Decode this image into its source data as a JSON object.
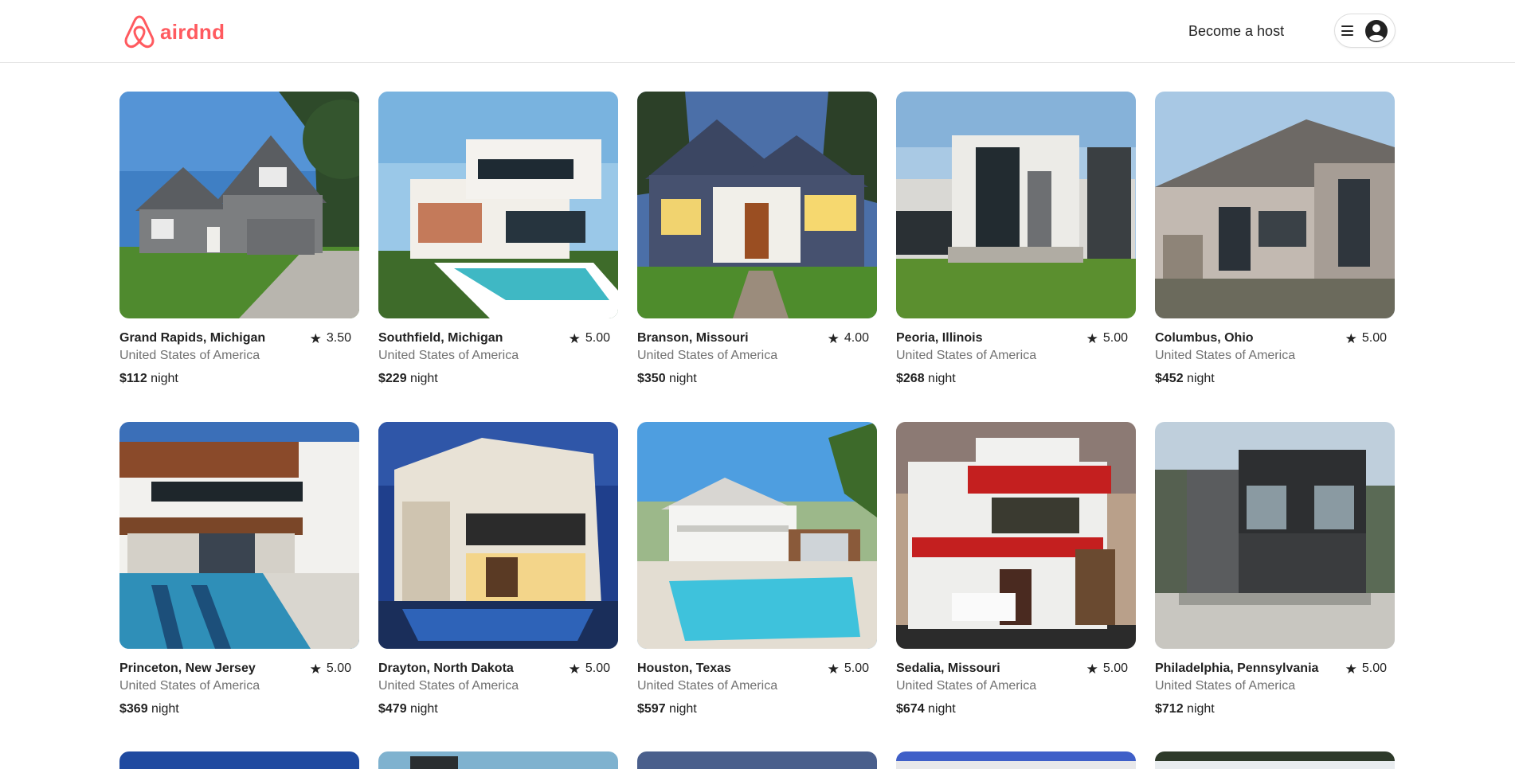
{
  "header": {
    "logo_text": "airdnd",
    "brand_color": "#ff5a5f",
    "host_label": "Become a host",
    "menu_icon": "hamburger-icon",
    "avatar_icon": "user-circle-icon"
  },
  "listings": [
    {
      "location": "Grand Rapids, Michigan",
      "country": "United States of America",
      "rating": "3.50",
      "price": "$112",
      "unit": "night"
    },
    {
      "location": "Southfield, Michigan",
      "country": "United States of America",
      "rating": "5.00",
      "price": "$229",
      "unit": "night"
    },
    {
      "location": "Branson, Missouri",
      "country": "United States of America",
      "rating": "4.00",
      "price": "$350",
      "unit": "night"
    },
    {
      "location": "Peoria, Illinois",
      "country": "United States of America",
      "rating": "5.00",
      "price": "$268",
      "unit": "night"
    },
    {
      "location": "Columbus, Ohio",
      "country": "United States of America",
      "rating": "5.00",
      "price": "$452",
      "unit": "night"
    },
    {
      "location": "Princeton, New Jersey",
      "country": "United States of America",
      "rating": "5.00",
      "price": "$369",
      "unit": "night"
    },
    {
      "location": "Drayton, North Dakota",
      "country": "United States of America",
      "rating": "5.00",
      "price": "$479",
      "unit": "night"
    },
    {
      "location": "Houston, Texas",
      "country": "United States of America",
      "rating": "5.00",
      "price": "$597",
      "unit": "night"
    },
    {
      "location": "Sedalia, Missouri",
      "country": "United States of America",
      "rating": "5.00",
      "price": "$674",
      "unit": "night"
    },
    {
      "location": "Philadelphia, Pennsylvania",
      "country": "United States of America",
      "rating": "5.00",
      "price": "$712",
      "unit": "night"
    }
  ],
  "star_icon": "★"
}
